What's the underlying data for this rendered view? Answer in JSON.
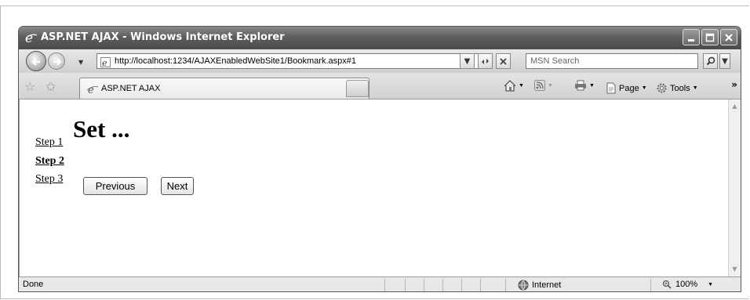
{
  "window": {
    "title": "ASP.NET AJAX - Windows Internet Explorer"
  },
  "address_bar": {
    "url": "http://localhost:1234/AJAXEnabledWebSite1/Bookmark.aspx#1"
  },
  "search": {
    "placeholder": "MSN Search"
  },
  "tab": {
    "label": "ASP.NET AJAX"
  },
  "commands": {
    "page_label": "Page",
    "tools_label": "Tools"
  },
  "page": {
    "steps": [
      "Step 1",
      "Step 2",
      "Step 3"
    ],
    "heading": "Set ...",
    "previous_label": "Previous",
    "next_label": "Next"
  },
  "status": {
    "text": "Done",
    "zone": "Internet",
    "zoom": "100%"
  },
  "icons": [
    "ie-logo-icon",
    "back-icon",
    "forward-icon",
    "refresh-icon",
    "stop-icon",
    "search-icon",
    "favorites-star-icon",
    "add-favorites-icon",
    "home-icon",
    "feeds-icon",
    "print-icon",
    "page-icon",
    "tools-icon",
    "globe-icon",
    "zoom-icon"
  ]
}
